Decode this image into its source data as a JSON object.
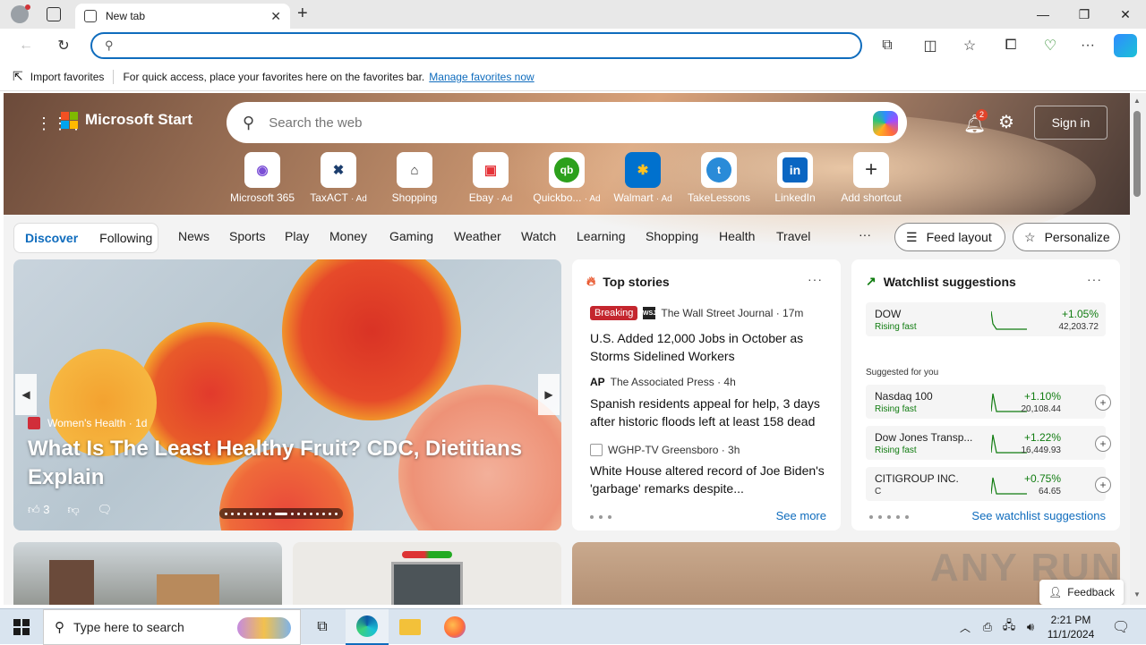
{
  "browser": {
    "tab_title": "New tab",
    "address_placeholder": "",
    "favorites_bar": {
      "import_label": "Import favorites",
      "message": "For quick access, place your favorites here on the favorites bar.",
      "manage_link": "Manage favorites now"
    }
  },
  "header": {
    "brand": "Microsoft Start",
    "search_placeholder": "Search the web",
    "notification_count": "2",
    "signin_label": "Sign in"
  },
  "shortcuts": [
    {
      "label": "Microsoft 365",
      "ad": ""
    },
    {
      "label": "TaxACT",
      "ad": "· Ad"
    },
    {
      "label": "Shopping",
      "ad": ""
    },
    {
      "label": "Ebay",
      "ad": "· Ad"
    },
    {
      "label": "Quickbo...",
      "ad": "· Ad"
    },
    {
      "label": "Walmart",
      "ad": "· Ad"
    },
    {
      "label": "TakeLessons",
      "ad": ""
    },
    {
      "label": "LinkedIn",
      "ad": ""
    },
    {
      "label": "Add shortcut",
      "ad": ""
    }
  ],
  "feed_tabs": [
    "Discover",
    "Following"
  ],
  "categories": [
    "News",
    "Sports",
    "Play",
    "Money",
    "Gaming",
    "Weather",
    "Watch",
    "Learning",
    "Shopping",
    "Health",
    "Travel"
  ],
  "more_glyph": "···",
  "feed_layout_label": "Feed layout",
  "personalize_label": "Personalize",
  "carousel": {
    "source": "Women's Health · 1d",
    "title": "What Is The Least Healthy Fruit? CDC, Dietitians Explain",
    "likes": "3"
  },
  "top_stories": {
    "heading": "Top stories",
    "items": [
      {
        "badge": "Breaking",
        "logo": "WSJ",
        "source": "The Wall Street Journal · 17m",
        "title": "U.S. Added 12,000 Jobs in October as Storms Sidelined Workers"
      },
      {
        "badge": "",
        "logo": "AP",
        "source": "The Associated Press · 4h",
        "title": "Spanish residents appeal for help, 3 days after historic floods left at least 158 dead"
      },
      {
        "badge": "",
        "logo": "",
        "source": "WGHP-TV Greensboro · 3h",
        "title": "White House altered record of Joe Biden's 'garbage' remarks despite..."
      }
    ],
    "see_more": "See more"
  },
  "watchlist": {
    "heading": "Watchlist suggestions",
    "main": {
      "name": "DOW",
      "status": "Rising fast",
      "change": "+1.05%",
      "price": "42,203.72"
    },
    "suggested_label": "Suggested for you",
    "suggested": [
      {
        "name": "Nasdaq 100",
        "status": "Rising fast",
        "change": "+1.10%",
        "price": "20,108.44"
      },
      {
        "name": "Dow Jones Transp...",
        "status": "Rising fast",
        "change": "+1.22%",
        "price": "16,449.93"
      },
      {
        "name": "CITIGROUP INC.",
        "status": "C",
        "change": "+0.75%",
        "price": "64.65"
      }
    ],
    "see_link": "See watchlist suggestions"
  },
  "feedback_label": "Feedback",
  "watermark": "ANY RUN",
  "taskbar": {
    "search_placeholder": "Type here to search",
    "time": "2:21 PM",
    "date": "11/1/2024"
  },
  "colors": {
    "accent": "#0f6cbd",
    "breaking": "#c4262e",
    "positive": "#107c10"
  }
}
